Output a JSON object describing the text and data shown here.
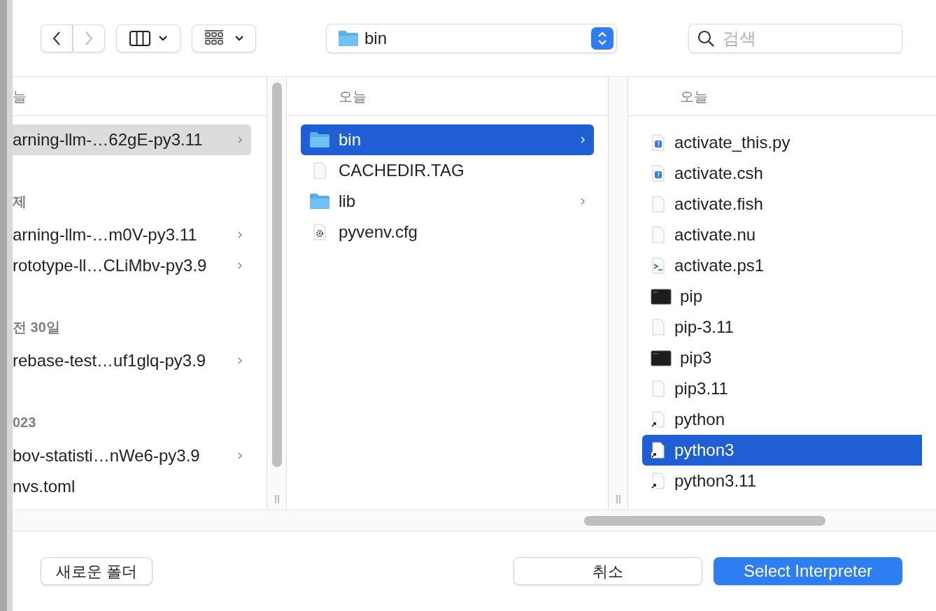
{
  "toolbar": {
    "back": {
      "disabled": false
    },
    "forward": {
      "disabled": true
    },
    "path": "bin",
    "search": {
      "placeholder": "검색"
    }
  },
  "column_1": {
    "header": "늘",
    "groups": [
      {
        "items": [
          {
            "name": "arning-llm-…62gE-py3.11",
            "selected": true,
            "expandable": true
          }
        ]
      },
      {
        "heading": "제",
        "items": [
          {
            "name": "arning-llm-…m0V-py3.11",
            "selected": false,
            "expandable": true
          },
          {
            "name": "rototype-ll…CLiMbv-py3.9",
            "selected": false,
            "expandable": true
          }
        ]
      },
      {
        "heading": "전 30일",
        "items": [
          {
            "name": "rebase-test…uf1glq-py3.9",
            "selected": false,
            "expandable": true
          }
        ]
      },
      {
        "heading": "023",
        "items": [
          {
            "name": "bov-statisti…nWe6-py3.9",
            "selected": false,
            "expandable": true
          },
          {
            "name": "nvs.toml",
            "selected": false,
            "expandable": false
          }
        ]
      }
    ]
  },
  "column_2": {
    "header": "오늘",
    "items": [
      {
        "name": "bin",
        "kind": "folder",
        "selected": true,
        "expandable": true
      },
      {
        "name": "CACHEDIR.TAG",
        "kind": "file",
        "selected": false,
        "expandable": false
      },
      {
        "name": "lib",
        "kind": "folder",
        "selected": false,
        "expandable": true
      },
      {
        "name": "pyvenv.cfg",
        "kind": "config",
        "selected": false,
        "expandable": false
      }
    ]
  },
  "column_3": {
    "header": "오늘",
    "items": [
      {
        "name": "activate_this.py",
        "kind": "script",
        "selected": false
      },
      {
        "name": "activate.csh",
        "kind": "script",
        "selected": false
      },
      {
        "name": "activate.fish",
        "kind": "file",
        "selected": false
      },
      {
        "name": "activate.nu",
        "kind": "file",
        "selected": false
      },
      {
        "name": "activate.ps1",
        "kind": "powershell",
        "selected": false
      },
      {
        "name": "pip",
        "kind": "terminal",
        "selected": false
      },
      {
        "name": "pip-3.11",
        "kind": "file",
        "selected": false
      },
      {
        "name": "pip3",
        "kind": "terminal",
        "selected": false
      },
      {
        "name": "pip3.11",
        "kind": "file",
        "selected": false
      },
      {
        "name": "python",
        "kind": "alias",
        "selected": false
      },
      {
        "name": "python3",
        "kind": "alias",
        "selected": true
      },
      {
        "name": "python3.11",
        "kind": "alias",
        "selected": false
      }
    ]
  },
  "buttons": {
    "new_folder": "새로운 폴더",
    "cancel": "취소",
    "confirm": "Select Interpreter"
  }
}
